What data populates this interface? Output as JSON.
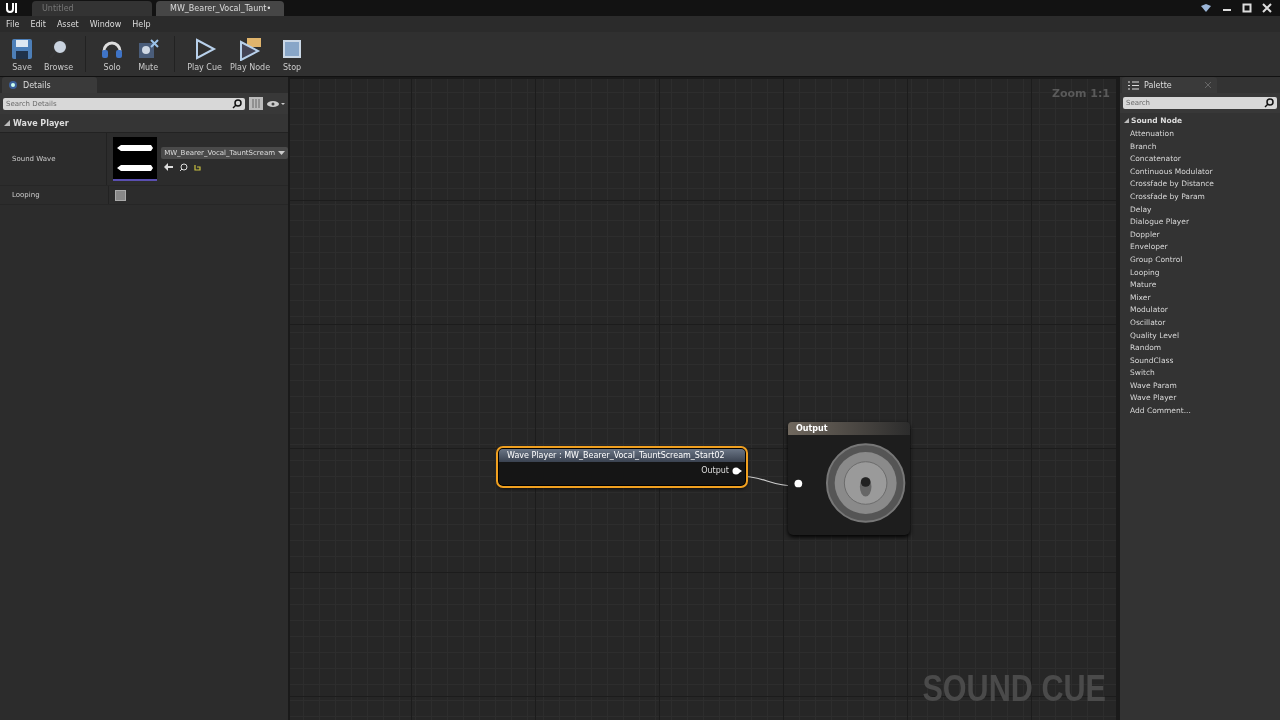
{
  "tabs": [
    {
      "label": "Untitled",
      "selected": false
    },
    {
      "label": "MW_Bearer_Vocal_Taunt•",
      "selected": true
    }
  ],
  "menu": [
    "File",
    "Edit",
    "Asset",
    "Window",
    "Help"
  ],
  "toolbar": [
    {
      "label": "Save",
      "kind": "save"
    },
    {
      "label": "Browse",
      "kind": "browse"
    },
    {
      "label": "Solo",
      "kind": "solo"
    },
    {
      "label": "Mute",
      "kind": "mute"
    },
    {
      "label": "Play Cue",
      "kind": "play"
    },
    {
      "label": "Play Node",
      "kind": "playnode"
    },
    {
      "label": "Stop",
      "kind": "stop"
    }
  ],
  "details": {
    "title": "Details",
    "search": {
      "placeholder": "Search Details"
    },
    "section": {
      "label": "Wave Player",
      "expanded": true
    },
    "properties": [
      {
        "kind": "asset",
        "label": "Sound Wave",
        "value": "MW_Bearer_Vocal_TauntScream"
      },
      {
        "kind": "checkbox",
        "label": "Looping",
        "checked": false
      }
    ]
  },
  "graph": {
    "zoom": "Zoom 1:1",
    "watermark": "SOUND CUE",
    "nodes": [
      {
        "kind": "wave",
        "title": "Wave Player : MW_Bearer_Vocal_TauntScream_Start02",
        "pin": "Output",
        "selected": true
      },
      {
        "kind": "output",
        "title": "Output",
        "selected": false
      }
    ]
  },
  "palette": {
    "title": "Palette",
    "search": {
      "placeholder": "Search"
    },
    "category": "Sound Node",
    "expanded": true,
    "items": [
      "Attenuation",
      "Branch",
      "Concatenator",
      "Continuous Modulator",
      "Crossfade by Distance",
      "Crossfade by Param",
      "Delay",
      "Dialogue Player",
      "Doppler",
      "Enveloper",
      "Group Control",
      "Looping",
      "Mature",
      "Mixer",
      "Modulator",
      "Oscillator",
      "Quality Level",
      "Random",
      "SoundClass",
      "Switch",
      "Wave Param",
      "Wave Player",
      "Add Comment..."
    ]
  }
}
